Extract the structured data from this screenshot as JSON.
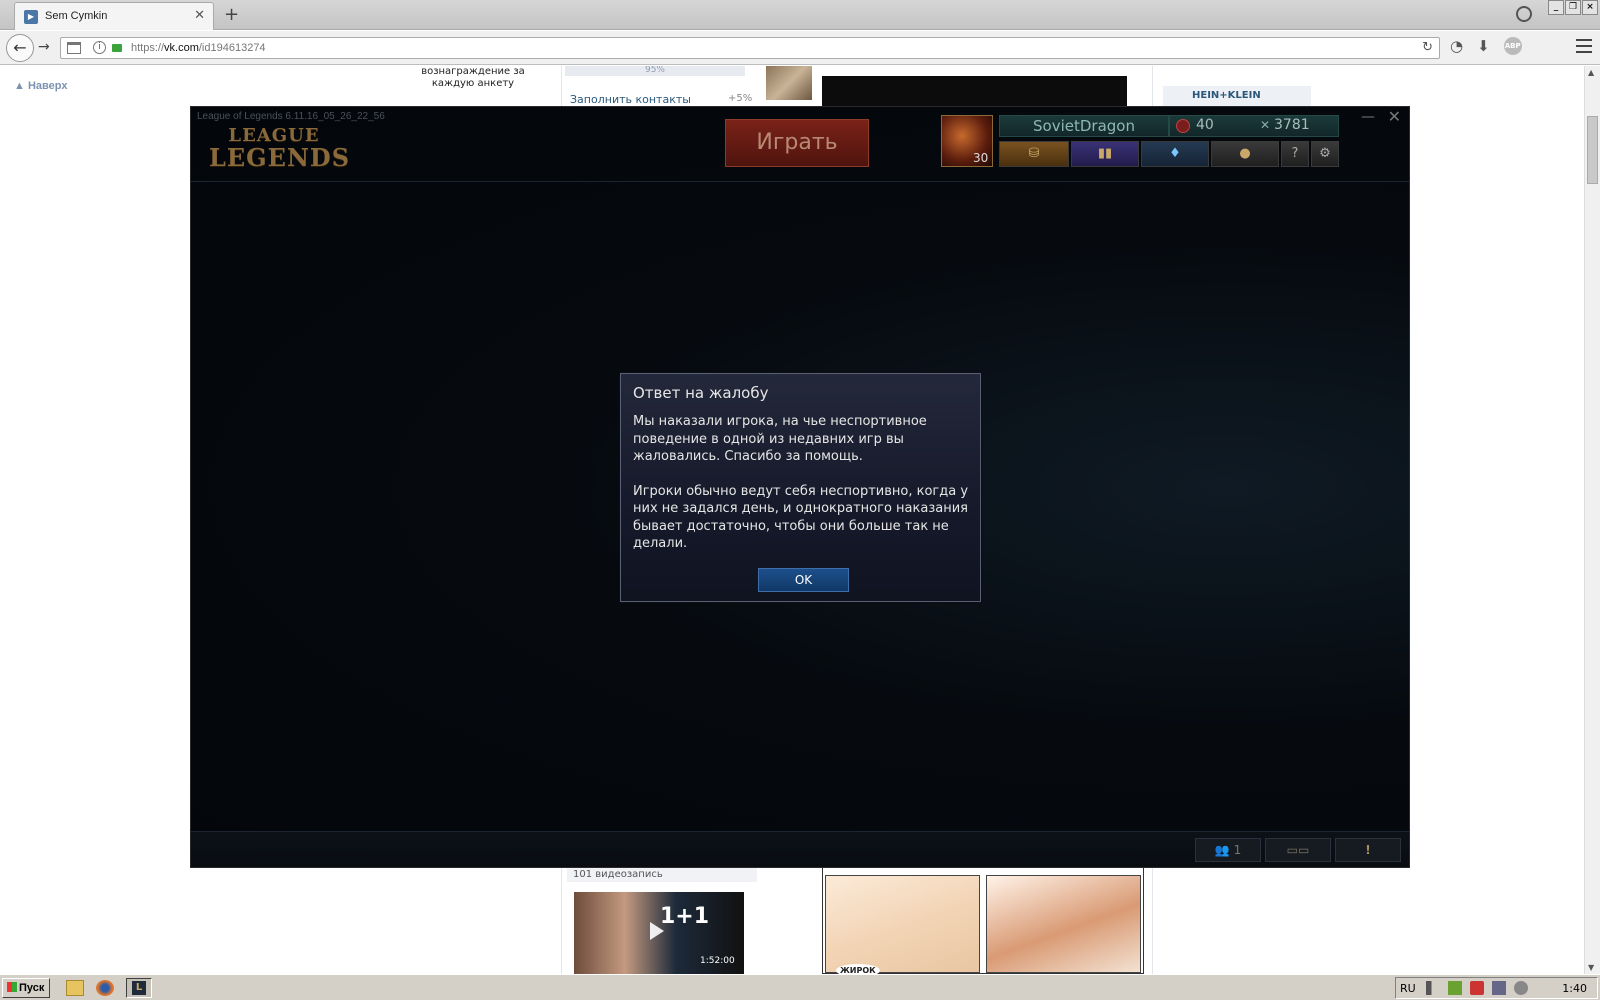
{
  "browser": {
    "tab_title": "Sem Cymkin",
    "tab_close": "✕",
    "new_tab": "+",
    "url_prefix": "https://",
    "url_domain": "vk.com",
    "url_path": "/id194613274",
    "abp_label": "ABP"
  },
  "vk": {
    "scroll_top": "Наверх",
    "reward_text": "вознаграждение за каждую анкету",
    "progress_pct": "95%",
    "fill_contacts": "Заполнить контакты",
    "fill_contacts_pct": "+5%",
    "right_title": "HEIN+KLEIN",
    "videos_count": "101 видеозапись",
    "video_title": "1+1",
    "video_duration": "1:52:00",
    "comic_label": "ЖИРОК"
  },
  "lol": {
    "build": "League of Legends 6.11.16_05_26_22_56",
    "logo_line1": "LEAGUE",
    "logo_line2": "LEGENDS",
    "play_button": "Играть",
    "level": "30",
    "summoner_name": "SovietDragon",
    "rp": "40",
    "ip": "3781",
    "friends_count": "1",
    "alert": "!"
  },
  "modal": {
    "title": "Ответ на жалобу",
    "paragraph1": "Мы наказали игрока, на чье неспортивное поведение в одной из недавних игр вы жаловались. Спасибо за помощь.",
    "paragraph2": "Игроки обычно ведут себя неспортивно, когда у них не задался день, и однократного наказания бывает достаточно, чтобы они больше так не делали.",
    "ok_button": "OK"
  },
  "taskbar": {
    "start": "Пуск",
    "lang": "RU",
    "clock": "1:40"
  }
}
